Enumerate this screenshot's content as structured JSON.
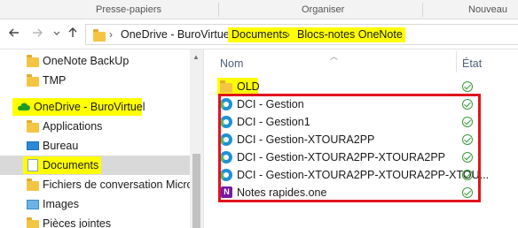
{
  "ribbon": {
    "groups": [
      "Presse-papiers",
      "Organiser",
      "Nouveau"
    ]
  },
  "navigation": {
    "back_icon": "arrow-left-icon",
    "forward_icon": "arrow-right-icon",
    "recent_icon": "chevron-down-icon",
    "up_icon": "arrow-up-icon"
  },
  "address_bar": {
    "segments": [
      "OneDrive - BuroVirtuel",
      "Documents",
      "Blocs-notes OneNote"
    ],
    "highlighted_segments": [
      "Documents",
      "Blocs-notes OneNote"
    ],
    "highlight_color": "#ffff00"
  },
  "nav_pane": {
    "items": [
      {
        "label": "OneNote BackUp",
        "icon": "folder-icon"
      },
      {
        "label": "TMP",
        "icon": "folder-icon"
      },
      {
        "label": "OneDrive - BuroVirtuel",
        "icon": "onedrive-cloud-icon",
        "highlighted": true
      },
      {
        "label": "Applications",
        "icon": "folder-icon"
      },
      {
        "label": "Bureau",
        "icon": "desktop-icon"
      },
      {
        "label": "Documents",
        "icon": "documents-icon",
        "selected": true,
        "highlighted": true
      },
      {
        "label": "Fichiers de conversation Microsoft",
        "icon": "folder-icon"
      },
      {
        "label": "Images",
        "icon": "pictures-icon"
      },
      {
        "label": "Pièces jointes",
        "icon": "folder-icon"
      }
    ]
  },
  "file_list": {
    "columns": {
      "name": "Nom",
      "status": "État"
    },
    "items": [
      {
        "name": "OLD",
        "icon": "folder-icon",
        "status": "synced-icon",
        "highlighted": true
      },
      {
        "name": "DCI - Gestion",
        "icon": "edge-link-icon",
        "status": "synced-icon"
      },
      {
        "name": "DCI - Gestion1",
        "icon": "edge-link-icon",
        "status": "synced-icon"
      },
      {
        "name": "DCI - Gestion-XTOURA2PP",
        "icon": "edge-link-icon",
        "status": "synced-icon"
      },
      {
        "name": "DCI - Gestion-XTOURA2PP-XTOURA2PP",
        "icon": "edge-link-icon",
        "status": "synced-icon"
      },
      {
        "name": "DCI - Gestion-XTOURA2PP-XTOURA2PP-XTOU...",
        "icon": "edge-link-icon",
        "status": "synced-icon"
      },
      {
        "name": "Notes rapides.one",
        "icon": "onenote-icon",
        "status": "synced-icon"
      }
    ],
    "annotation_color": "#e0141d"
  }
}
